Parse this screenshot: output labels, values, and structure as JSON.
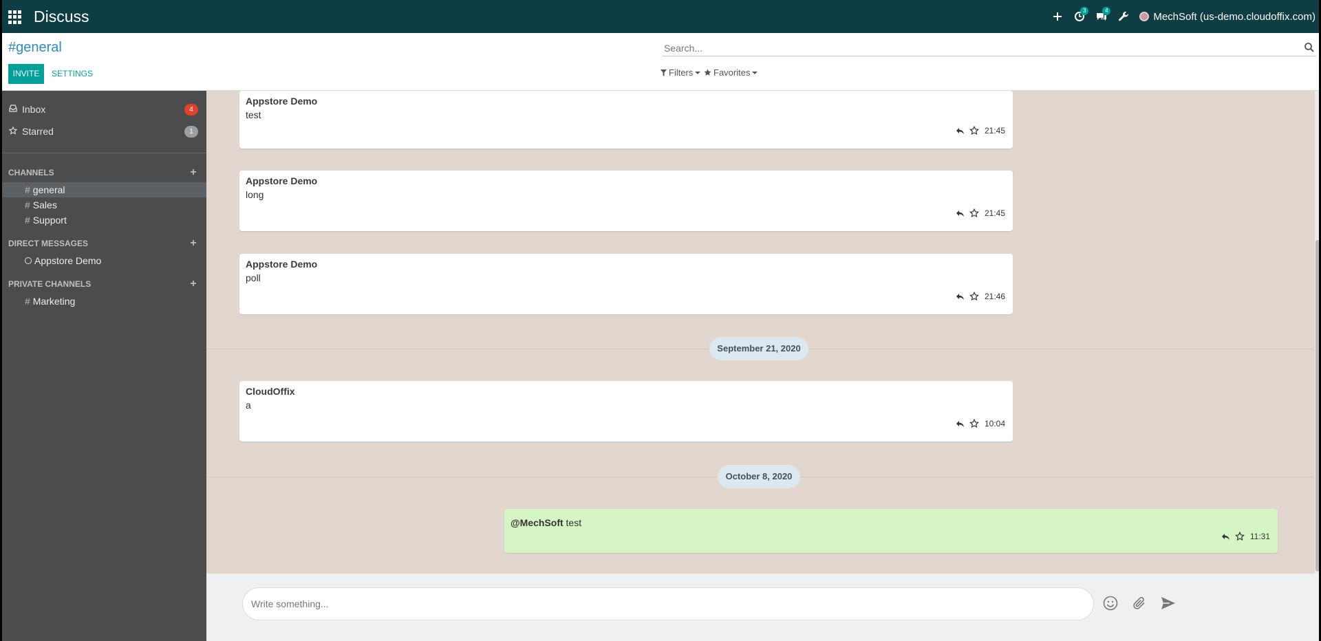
{
  "navbar": {
    "brand": "Discuss",
    "activities_badge": "3",
    "messages_badge": "4",
    "user_label": "MechSoft (us-demo.cloudoffix.com)",
    "icons": [
      "apps-icon",
      "plus-icon",
      "clock-icon",
      "chat-icon",
      "wrench-icon",
      "avatar"
    ]
  },
  "control_panel": {
    "title": "#general",
    "invite_label": "INVITE",
    "settings_label": "SETTINGS",
    "search_placeholder": "Search...",
    "filters_label": "Filters",
    "favorites_label": "Favorites"
  },
  "sidebar": {
    "mailboxes": [
      {
        "label": "Inbox",
        "count": "4",
        "icon": "inbox-icon"
      },
      {
        "label": "Starred",
        "count": "1",
        "icon": "star-icon"
      }
    ],
    "channels_header": "CHANNELS",
    "channels": [
      {
        "label": "general",
        "active": true
      },
      {
        "label": "Sales",
        "active": false
      },
      {
        "label": "Support",
        "active": false
      }
    ],
    "dm_header": "DIRECT MESSAGES",
    "direct_messages": [
      {
        "label": "Appstore Demo"
      }
    ],
    "private_header": "PRIVATE CHANNELS",
    "private_channels": [
      {
        "label": "Marketing"
      }
    ]
  },
  "thread": {
    "messages": [
      {
        "author": "Appstore Demo",
        "body": "test",
        "time": "21:45"
      },
      {
        "author": "Appstore Demo",
        "body": "long",
        "time": "21:45"
      },
      {
        "author": "Appstore Demo",
        "body": "poll",
        "time": "21:46"
      },
      {
        "date": "September 21, 2020"
      },
      {
        "author": "CloudOffix",
        "body": "a",
        "time": "10:04"
      },
      {
        "date": "October 8, 2020"
      },
      {
        "mention": "@MechSoft",
        "body": " test",
        "time": "11:31",
        "mine": true
      }
    ]
  },
  "composer": {
    "placeholder": "Write something...",
    "icons": [
      "emoji-icon",
      "paperclip-icon",
      "send-icon"
    ]
  },
  "colors": {
    "navbar": "#0f3d44",
    "accent": "#00a09d",
    "sidebar": "#4c4c4c",
    "thread_bg": "#e1d7cf",
    "own_message": "#d6f5c4",
    "badge_red": "#e2412b"
  }
}
